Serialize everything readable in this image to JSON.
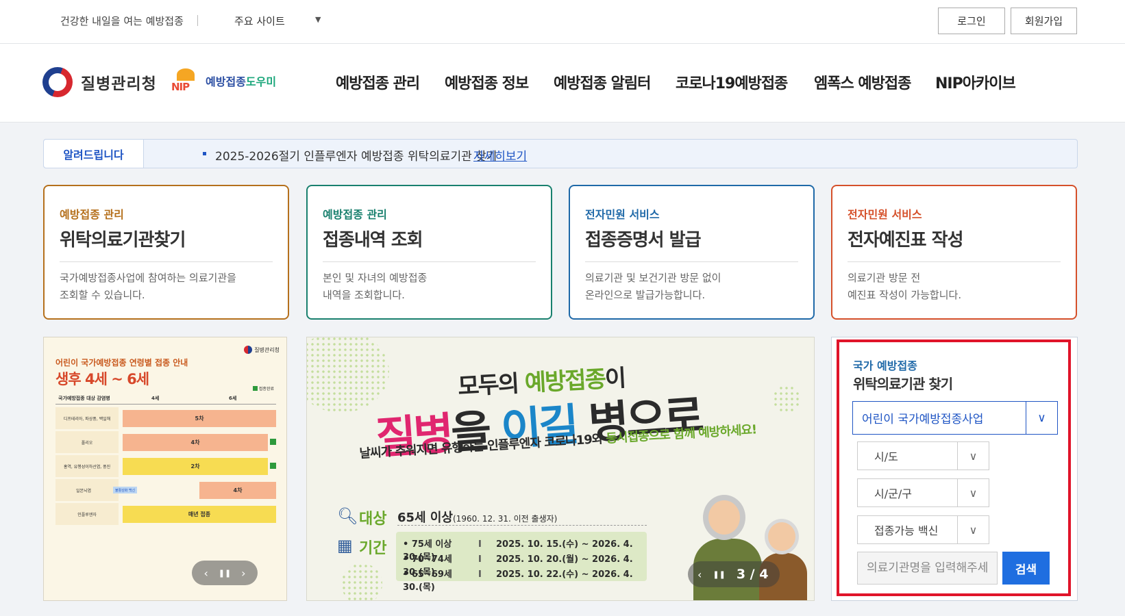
{
  "topbar": {
    "slogan": "건강한 내일을 여는 예방접종",
    "sites_label": "주요 사이트",
    "login": "로그인",
    "join": "회원가입"
  },
  "header": {
    "kdca_name": "질병관리청",
    "nip_badge": "NIP",
    "nip_name_a": "예방접종",
    "nip_name_b": "도우미",
    "nav": [
      "예방접종 관리",
      "예방접종 정보",
      "예방접종 알림터",
      "코로나19예방접종",
      "엠폭스 예방접종",
      "NIP아카이브"
    ]
  },
  "notice": {
    "tag": "알려드립니다",
    "text": "2025-2026절기 인플루엔자 예방접종 위탁의료기관 찾기",
    "more": "자세히보기"
  },
  "cards": [
    {
      "category": "예방접종 관리",
      "title": "위탁의료기관찾기",
      "desc": "국가예방접종사업에 참여하는 의료기관을\n조회할 수 있습니다."
    },
    {
      "category": "예방접종 관리",
      "title": "접종내역 조회",
      "desc": "본인 및 자녀의 예방접종\n내역을 조회합니다."
    },
    {
      "category": "전자민원 서비스",
      "title": "접종증명서 발급",
      "desc": "의료기관 및 보건기관 방문 없이\n온라인으로 발급가능합니다."
    },
    {
      "category": "전자민원 서비스",
      "title": "전자예진표 작성",
      "desc": "의료기관 방문 전\n예진표 작성이 가능합니다."
    }
  ],
  "banner_left": {
    "logo": "질병관리청",
    "subtitle": "어린이 국가예방접종 연령별 접종 안내",
    "title": "생후 4세 ~ 6세",
    "legend": "접종완료",
    "head_col1": "국가예방접종 대상 감염병",
    "head_col2": "4세",
    "head_col3": "6세",
    "rows": [
      {
        "label": "디프테리아, 파상풍, 백일해",
        "bar": "5차",
        "bar_color": "#f6b48f"
      },
      {
        "label": "폴리오",
        "bar": "4차",
        "bar_color": "#f6b48f"
      },
      {
        "label": "홍역, 유행성이하선염, 풍진",
        "bar": "2차",
        "bar_color": "#f7dc52"
      },
      {
        "label": "일본뇌염",
        "tag": "불활성화 백신",
        "bar": "4차",
        "bar_color": "#f6b48f"
      },
      {
        "label": "인플루엔자",
        "bar": "매년 접종",
        "bar_color": "#f7dc52"
      }
    ],
    "prev": "‹",
    "pause": "❚❚",
    "next": "›"
  },
  "banner_center": {
    "line1_a": "모두의 ",
    "line1_b": "예방접종",
    "line1_c": "이",
    "line2_a": "질병",
    "line2_b": "을 ",
    "line2_c": "이길",
    "line2_d": " 병으로",
    "line3_a": "날씨가 추워지면 유행하는 인플루엔자 코로나19와 ",
    "line3_b": "동시접종으로 함께 예방하세요!",
    "target_key": "대상",
    "target_val": "65세 이상",
    "target_note": "(1960. 12. 31. 이전 출생자)",
    "period_key": "기간",
    "periods": [
      {
        "age": "• 75세 이상",
        "sep": "I",
        "date": "2025. 10. 15.(수) ~ 2026. 4. 30.(목)"
      },
      {
        "age": "• 70~74세",
        "sep": "I",
        "date": "2025. 10. 20.(월) ~ 2026. 4. 30.(목)"
      },
      {
        "age": "• 65~69세",
        "sep": "I",
        "date": "2025. 10. 22.(수) ~ 2026. 4. 30.(목)"
      }
    ],
    "pager_prev": "‹",
    "pager_pause": "❚❚",
    "pager_next": "›",
    "pager_count": "3 / 4"
  },
  "search": {
    "subtitle": "국가 예방접종",
    "title": "위탁의료기관 찾기",
    "program_value": "어린이 국가예방접종사업",
    "sido": "시/도",
    "sigungu": "시/군/구",
    "vaccine": "접종가능 백신",
    "input_placeholder": "의료기관명을 입력해주세",
    "button": "검색"
  },
  "colors": {
    "highlight_frame": "#e0142a",
    "primary": "#1f55c4",
    "search_button": "#1f6ee0"
  }
}
